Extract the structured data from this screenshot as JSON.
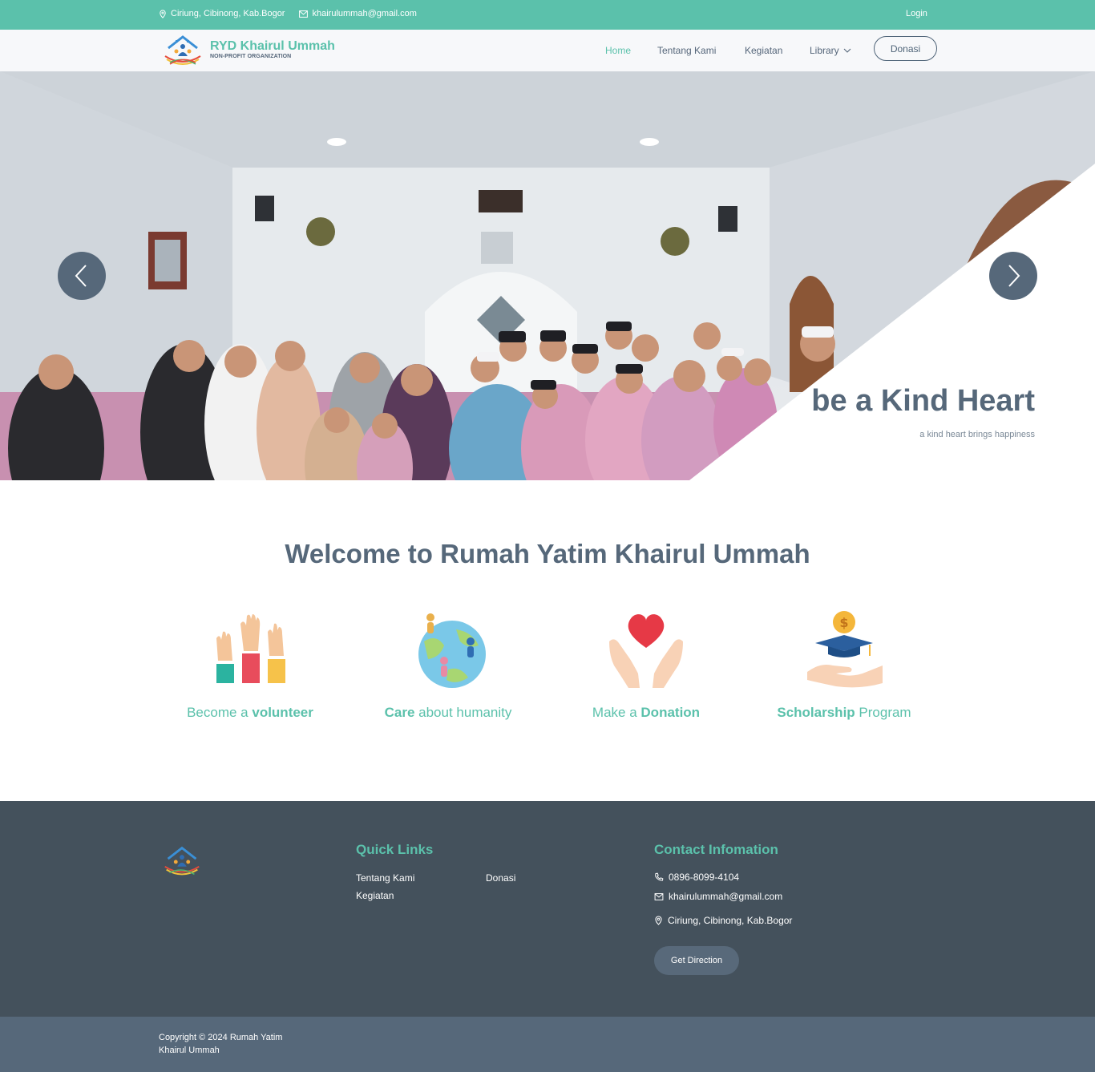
{
  "topbar": {
    "address": "Ciriung, Cibinong, Kab.Bogor",
    "email": "khairulummah@gmail.com",
    "login_label": "Login"
  },
  "header": {
    "brand_name": "RYD Khairul Ummah",
    "brand_tagline": "NON-PROFIT ORGANIZATION",
    "nav": {
      "home": "Home",
      "about": "Tentang Kami",
      "activities": "Kegiatan",
      "library": "Library"
    },
    "donate_label": "Donasi"
  },
  "hero": {
    "title": "be a Kind Heart",
    "subtitle": "a kind heart brings happiness"
  },
  "welcome": {
    "heading": "Welcome to Rumah Yatim Khairul Ummah",
    "features": [
      {
        "pre": "Become a ",
        "bold": "volunteer",
        "post": "",
        "icon": "raised-hands-icon"
      },
      {
        "pre": "",
        "bold": "Care",
        "post": " about humanity",
        "icon": "globe-people-icon"
      },
      {
        "pre": "Make a ",
        "bold": "Donation",
        "post": "",
        "icon": "heart-hands-icon"
      },
      {
        "pre": "",
        "bold": "Scholarship",
        "post": " Program",
        "icon": "scholarship-icon"
      }
    ]
  },
  "footer": {
    "quick_links_heading": "Quick Links",
    "links": {
      "about": "Tentang Kami",
      "donate": "Donasi",
      "activities": "Kegiatan"
    },
    "contact_heading": "Contact Infomation",
    "phone": "0896-8099-4104",
    "email": "khairulummah@gmail.com",
    "address": "Ciriung, Cibinong, Kab.Bogor",
    "direction_label": "Get Direction"
  },
  "copyright": "Copyright © 2024 Rumah Yatim Khairul Ummah",
  "colors": {
    "accent": "#5bc1ab",
    "dark": "#56687a",
    "footer": "#44515c"
  }
}
